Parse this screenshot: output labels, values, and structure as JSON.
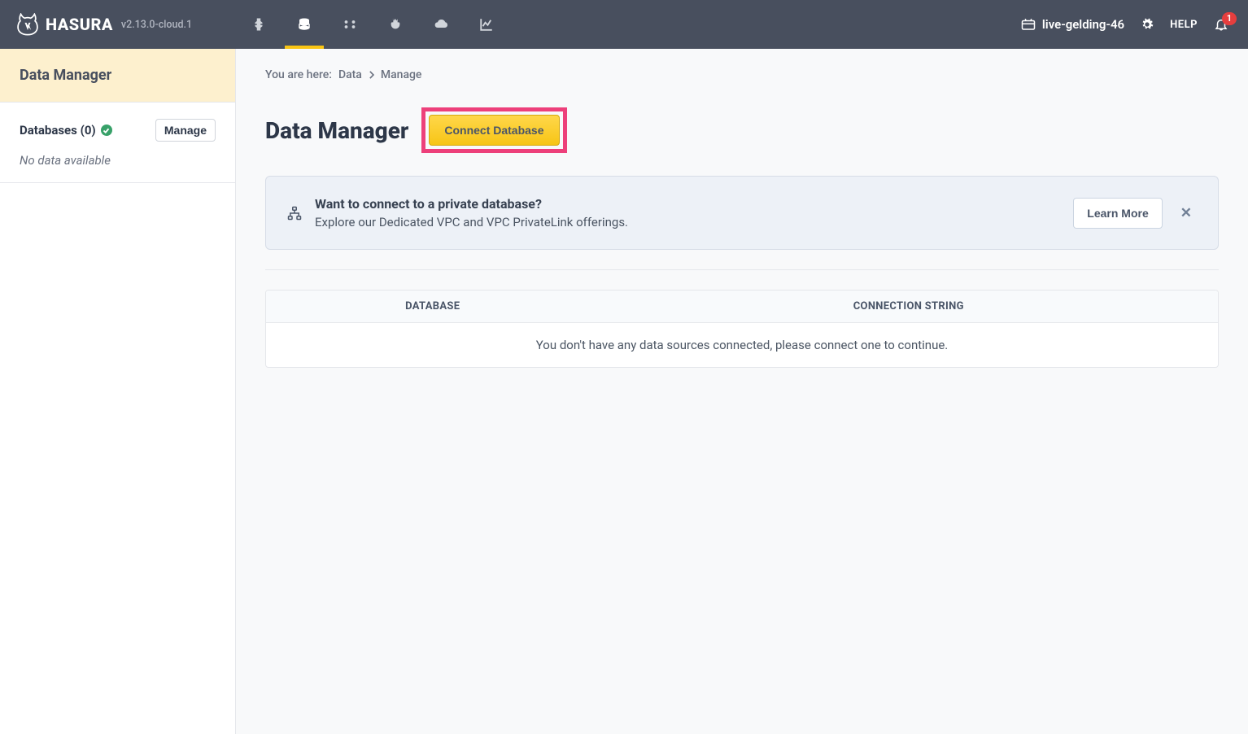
{
  "header": {
    "brand": "HASURA",
    "version": "v2.13.0-cloud.1",
    "project_name": "live-gelding-46",
    "help_label": "HELP",
    "notification_count": "1"
  },
  "sidebar": {
    "title": "Data Manager",
    "databases_label": "Databases (0)",
    "manage_label": "Manage",
    "no_data_text": "No data available"
  },
  "breadcrumb": {
    "prefix": "You are here:",
    "data_label": "Data",
    "current": "Manage"
  },
  "main": {
    "title": "Data Manager",
    "connect_button": "Connect Database"
  },
  "banner": {
    "title": "Want to connect to a private database?",
    "subtitle": "Explore our Dedicated VPC and VPC PrivateLink offerings.",
    "learn_more": "Learn More"
  },
  "table": {
    "col_database": "DATABASE",
    "col_connection": "CONNECTION STRING",
    "empty_message": "You don't have any data sources connected, please connect one to continue."
  }
}
